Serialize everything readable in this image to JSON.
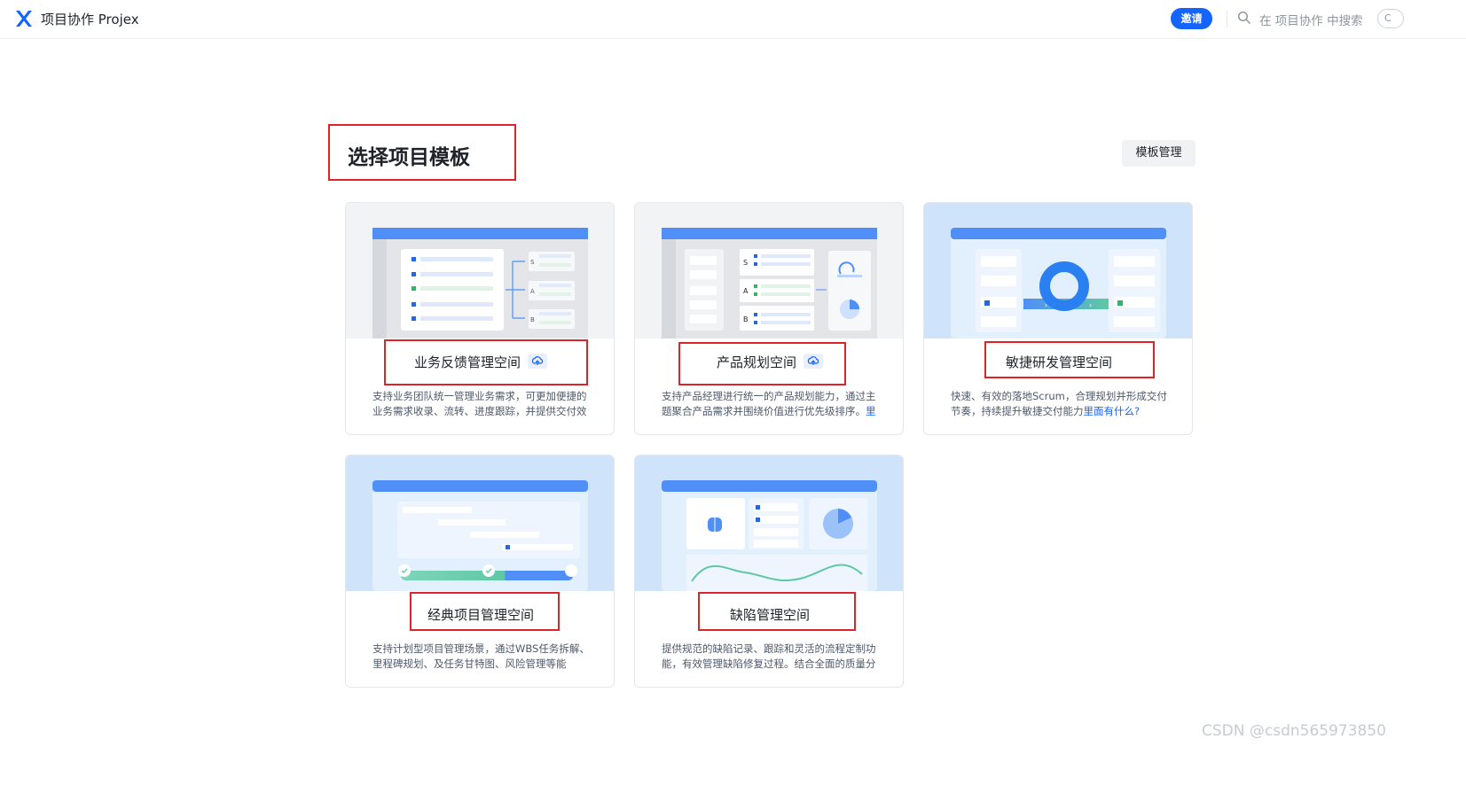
{
  "header": {
    "app_title": "项目协作 Projex",
    "invite_label": "邀请",
    "search_placeholder": "在 项目协作 中搜索",
    "edge_label": "C",
    "logo_icon": "x-logo-icon",
    "accent": "#1664ff"
  },
  "main": {
    "title": "选择项目模板",
    "template_manage_label": "模板管理"
  },
  "cards": [
    {
      "name": "业务反馈管理空间",
      "desc": "支持业务团队统一管理业务需求，可更加便捷的业务需求收录、流转、进度跟踪，并提供交付效",
      "link": "",
      "badge_icon": "cloud-sync-icon"
    },
    {
      "name": "产品规划空间",
      "desc": "支持产品经理进行统一的产品规划能力，通过主题聚合产品需求并围绕价值进行优先级排序。",
      "link": "里",
      "badge_icon": "cloud-sync-icon"
    },
    {
      "name": "敏捷研发管理空间",
      "desc": "快速、有效的落地Scrum，合理规划并形成交付节奏，持续提升敏捷交付能力",
      "link": "里面有什么?"
    },
    {
      "name": "经典项目管理空间",
      "desc": "支持计划型项目管理场景，通过WBS任务拆解、里程碑规划、及任务甘特图、风险管理等能",
      "link": ""
    },
    {
      "name": "缺陷管理空间",
      "desc": "提供规范的缺陷记录、跟踪和灵活的流程定制功能，有效管理缺陷修复过程。结合全面的质量分",
      "link": ""
    }
  ],
  "illustration_labels": {
    "s": "S",
    "a": "A",
    "b": "B"
  },
  "watermark": "CSDN @csdn565973850"
}
